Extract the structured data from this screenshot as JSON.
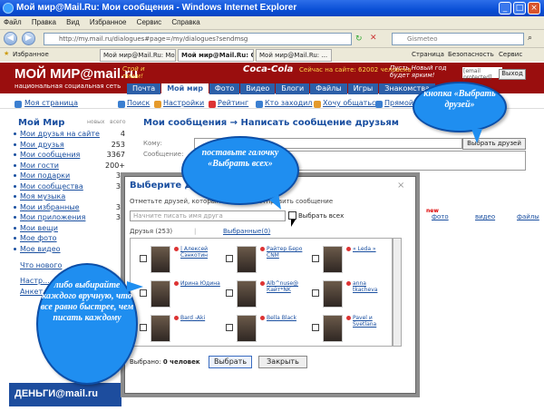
{
  "window": {
    "title": "Мой мир@Mail.Ru: Мои сообщения - Windows Internet Explorer"
  },
  "menu": [
    "Файл",
    "Правка",
    "Вид",
    "Избранное",
    "Сервис",
    "Справка"
  ],
  "address": {
    "url": "http://my.mail.ru/dialogues#page=/my/dialogues?sendmsg",
    "search_placeholder": "Gismeteo"
  },
  "tabs": {
    "favorites": "Избранное",
    "tab1": "Мой мир@Mail.Ru: Мо...",
    "tab2": "Мой мир@Mail.Ru: Со...",
    "tab3": "Мой мир@Mail.Ru: ...",
    "page": "Страница",
    "safety": "Безопасность",
    "service": "Сервис"
  },
  "header": {
    "logo": "МОЙ МИР@mail.ru",
    "logo_sub": "национальная социальная сеть",
    "promo": "Стой и пиши!",
    "brand": "Coca-Cola",
    "online": "Сейчас на сайте: 62002 человека",
    "slogan": "Пусть Новый год будет ярким!",
    "email": "[email protected]",
    "logout": "Выход"
  },
  "nav": [
    "Почта",
    "Мой мир",
    "Фото",
    "Видео",
    "Блоги",
    "Файлы",
    "Игры",
    "Знакомства"
  ],
  "toolbar": {
    "home": "Моя страница",
    "search": "Поиск",
    "settings": "Настройки",
    "rating": "Рейтинг",
    "guestbook": "Кто заходил",
    "want": "Хочу общаться",
    "live": "Прямой эфир"
  },
  "sidebar": {
    "title": "Мой Мир",
    "head_new": "новых",
    "head_all": "всего",
    "items": [
      {
        "label": "Мои друзья на сайте",
        "count": "4"
      },
      {
        "label": "Мои друзья",
        "count": "253"
      },
      {
        "label": "Мои сообщения",
        "count": "3367"
      },
      {
        "label": "Мои гости",
        "count": "200+"
      },
      {
        "label": "Мои подарки",
        "count": "34"
      },
      {
        "label": "Мои сообщества",
        "count": "34"
      },
      {
        "label": "Моя музыка",
        "count": "6"
      },
      {
        "label": "Мои избранные",
        "count": "34"
      },
      {
        "label": "Мои приложения",
        "count": "34"
      },
      {
        "label": "Мои вещи",
        "count": ""
      },
      {
        "label": "Мое фото",
        "count": ""
      },
      {
        "label": "Мое видео",
        "count": ""
      }
    ],
    "more": "Что нового",
    "settings": "Настр...",
    "anketa": "Анкет...",
    "money": "ДЕНЬГИ@mail.ru"
  },
  "main": {
    "breadcrumb": "Мои сообщения → Написать сообщение друзьям",
    "to_label": "Кому:",
    "msg_label": "Сообщение:",
    "pick_button": "Выбрать друзей"
  },
  "modal": {
    "title": "Выберите друзей",
    "close": "×",
    "hint": "Отметьте друзей, которым вы хотите отправить сообщение",
    "search_placeholder": "Начните писать имя друга",
    "select_all": "Выбрать всех",
    "friends_tab": "Друзья (253)",
    "selected_tab": "Выбранные(0)",
    "friends": [
      {
        "name": "| Алексей Сэнкотин"
      },
      {
        "name": "Райтер Беро CNM"
      },
      {
        "name": "« Leda »"
      },
      {
        "name": "Ирина Юдина"
      },
      {
        "name": "Alb^nuse@ Кайт*NK"
      },
      {
        "name": "anna tkacheva"
      },
      {
        "name": "Bard -Aki"
      },
      {
        "name": "Bella Black"
      },
      {
        "name": "Pavel и Svetlana"
      }
    ],
    "selected_count_label": "Выбрано:",
    "selected_count": "0 человек",
    "ok": "Выбрать",
    "cancel": "Закрыть"
  },
  "right": {
    "new": "new",
    "photo": "фото",
    "video": "видео",
    "files": "файлы"
  },
  "callouts": {
    "button": "кнопка «Выбрать друзей»",
    "select_all": "поставьте галочку «Выбрать всех»",
    "manual": "либо выбирайте каждого вручную, что все равно быстрее, чем писать каждому"
  }
}
